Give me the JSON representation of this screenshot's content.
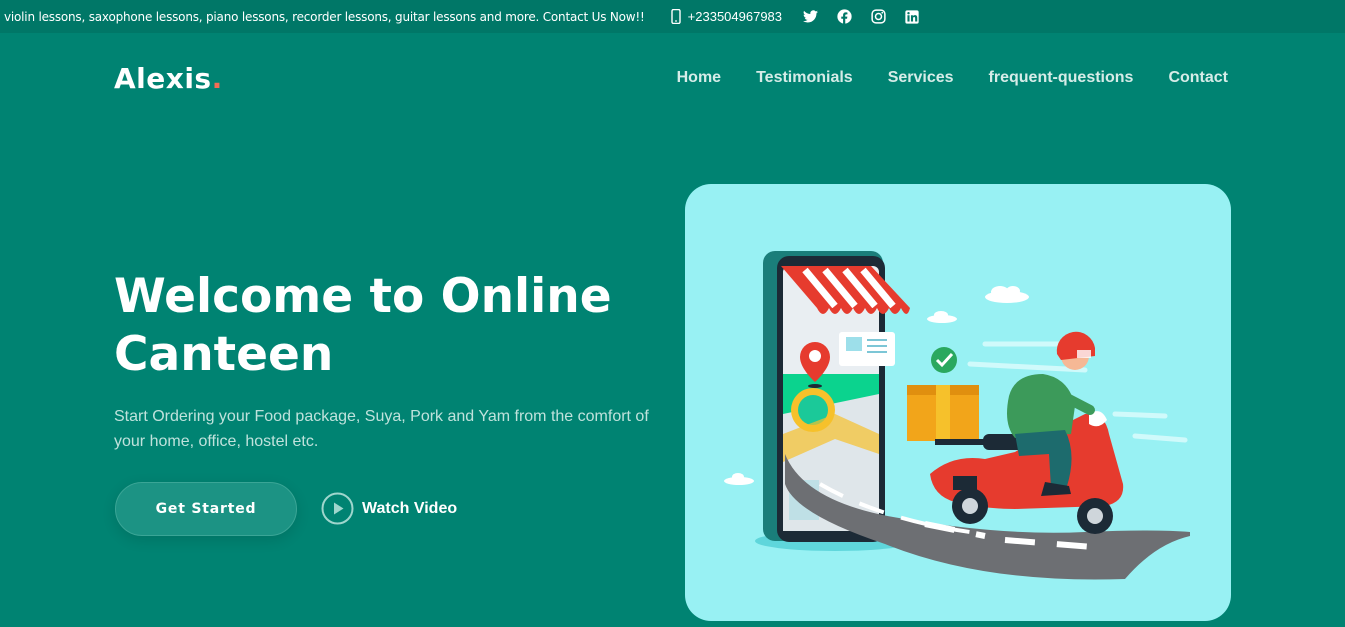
{
  "topbar": {
    "marquee": "violin lessons, saxophone lessons, piano lessons, recorder lessons, guitar lessons and more. Contact Us Now!!",
    "phone": "+233504967983",
    "phone_icon": "mobile-phone-icon",
    "socials": [
      "twitter-icon",
      "facebook-icon",
      "instagram-icon",
      "linkedin-icon"
    ]
  },
  "brand": {
    "name": "Alexis",
    "dot": ".",
    "dot_color": "#f26d54"
  },
  "nav": {
    "items": [
      {
        "label": "Home"
      },
      {
        "label": "Testimonials"
      },
      {
        "label": "Services"
      },
      {
        "label": "frequent-questions"
      },
      {
        "label": "Contact"
      }
    ]
  },
  "hero": {
    "title": "Welcome to Online Canteen",
    "subtitle": "Start Ordering your Food package, Suya, Pork and Yam from the comfort of your home, office, hostel etc.",
    "cta_label": "Get Started",
    "video_label": "Watch Video",
    "video_icon": "play-circle-icon",
    "illustration": "delivery-scooter-illustration"
  },
  "colors": {
    "background": "#008372",
    "topbar": "#007767",
    "card": "#98f1f3",
    "accent": "#f26d54"
  }
}
